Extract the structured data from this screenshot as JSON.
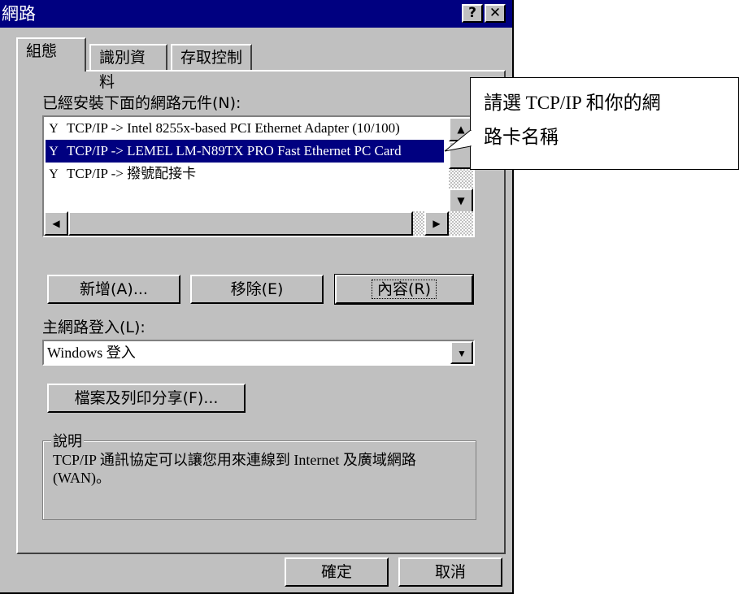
{
  "window": {
    "title": "網路",
    "help_btn": "?",
    "close_btn": "✕"
  },
  "tabs": [
    {
      "label": "組態",
      "active": true
    },
    {
      "label": "識別資料",
      "active": false
    },
    {
      "label": "存取控制",
      "active": false
    }
  ],
  "components": {
    "label": "已經安裝下面的網路元件(N):",
    "items": [
      {
        "icon": "network-protocol-icon",
        "text": "TCP/IP -> Intel 8255x-based PCI Ethernet Adapter (10/100)",
        "selected": false
      },
      {
        "icon": "network-protocol-icon",
        "text": "TCP/IP -> LEMEL LM-N89TX PRO Fast Ethernet PC Card",
        "selected": true
      },
      {
        "icon": "network-protocol-icon",
        "text": "TCP/IP -> 撥號配接卡",
        "selected": false
      }
    ]
  },
  "buttons": {
    "add": "新增(A)...",
    "remove": "移除(E)",
    "properties": "內容(R)"
  },
  "logon": {
    "label": "主網路登入(L):",
    "value": "Windows 登入"
  },
  "share_btn": "檔案及列印分享(F)...",
  "description": {
    "title": "說明",
    "text": "TCP/IP 通訊協定可以讓您用來連線到 Internet 及廣域網路 (WAN)。"
  },
  "footer": {
    "ok": "確定",
    "cancel": "取消"
  },
  "callout": {
    "line1": "請選 TCP/IP 和你的網",
    "line2": "路卡名稱"
  }
}
